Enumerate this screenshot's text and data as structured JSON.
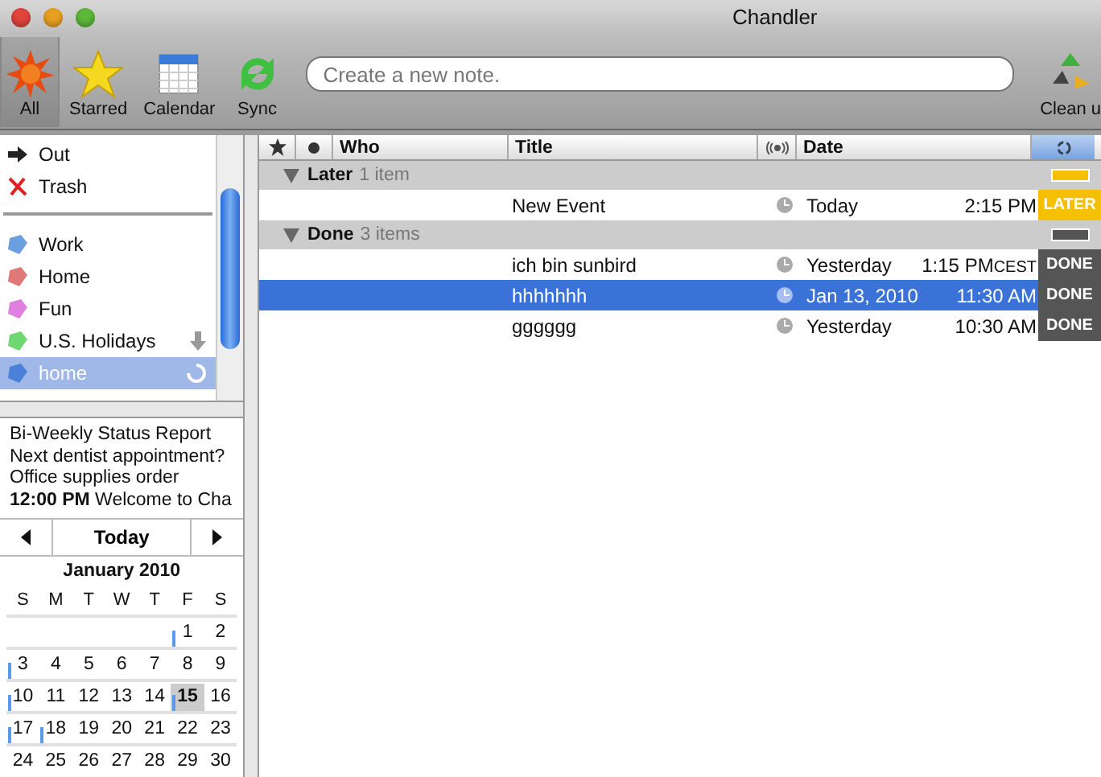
{
  "window": {
    "title": "Chandler"
  },
  "toolbar": {
    "buttons": [
      {
        "label": "All",
        "kind": "all",
        "selected": true
      },
      {
        "label": "Starred",
        "kind": "starred",
        "selected": false
      },
      {
        "label": "Calendar",
        "kind": "calendar",
        "selected": false
      },
      {
        "label": "Sync",
        "kind": "sync",
        "selected": false
      }
    ],
    "search": {
      "placeholder": "Create a new note."
    },
    "clean_button": {
      "label": "Clean u"
    }
  },
  "sidebar": {
    "top_items": [
      {
        "label": "Out",
        "kind": "out"
      },
      {
        "label": "Trash",
        "kind": "trash"
      }
    ],
    "collections": [
      {
        "label": "Work",
        "color": "#6a9fe0",
        "selected": false,
        "subscribed": false,
        "syncing": false
      },
      {
        "label": "Home",
        "color": "#e07878",
        "selected": false,
        "subscribed": false,
        "syncing": false
      },
      {
        "label": "Fun",
        "color": "#e080e0",
        "selected": false,
        "subscribed": false,
        "syncing": false
      },
      {
        "label": "U.S. Holidays",
        "color": "#70d870",
        "selected": false,
        "subscribed": true,
        "syncing": false
      },
      {
        "label": "home",
        "color": "#4a80d8",
        "selected": true,
        "subscribed": false,
        "syncing": true
      }
    ]
  },
  "preview": {
    "lines": [
      "Bi-Weekly Status Report",
      "Next dentist appointment?",
      "Office supplies order",
      "**12:00 PM** Welcome to Cha"
    ]
  },
  "mini_calendar": {
    "today_button": "Today",
    "month": "January 2010",
    "weekdays": [
      "S",
      "M",
      "T",
      "W",
      "T",
      "F",
      "S"
    ],
    "weeks": [
      {
        "partial_start": true,
        "days": [
          {
            "day": "1",
            "event": true,
            "selected": false
          },
          {
            "day": "2",
            "event": false,
            "selected": false
          }
        ]
      },
      {
        "days": [
          {
            "day": "3",
            "event": true,
            "selected": false
          },
          {
            "day": "4",
            "event": false,
            "selected": false
          },
          {
            "day": "5",
            "event": false,
            "selected": false
          },
          {
            "day": "6",
            "event": false,
            "selected": false
          },
          {
            "day": "7",
            "event": false,
            "selected": false
          },
          {
            "day": "8",
            "event": false,
            "selected": false
          },
          {
            "day": "9",
            "event": false,
            "selected": false
          }
        ]
      },
      {
        "days": [
          {
            "day": "10",
            "event": true,
            "selected": false
          },
          {
            "day": "11",
            "event": false,
            "selected": false
          },
          {
            "day": "12",
            "event": false,
            "selected": false
          },
          {
            "day": "13",
            "event": false,
            "selected": false
          },
          {
            "day": "14",
            "event": false,
            "selected": false
          },
          {
            "day": "15",
            "event": true,
            "selected": true
          },
          {
            "day": "16",
            "event": false,
            "selected": false
          }
        ]
      },
      {
        "days": [
          {
            "day": "17",
            "event": true,
            "selected": false
          },
          {
            "day": "18",
            "event": true,
            "selected": false
          },
          {
            "day": "19",
            "event": false,
            "selected": false
          },
          {
            "day": "20",
            "event": false,
            "selected": false
          },
          {
            "day": "21",
            "event": false,
            "selected": false
          },
          {
            "day": "22",
            "event": false,
            "selected": false
          },
          {
            "day": "23",
            "event": false,
            "selected": false
          }
        ]
      },
      {
        "days": [
          {
            "day": "24",
            "event": false,
            "selected": false
          },
          {
            "day": "25",
            "event": false,
            "selected": false
          },
          {
            "day": "26",
            "event": false,
            "selected": false
          },
          {
            "day": "27",
            "event": false,
            "selected": false
          },
          {
            "day": "28",
            "event": false,
            "selected": false
          },
          {
            "day": "29",
            "event": false,
            "selected": false
          },
          {
            "day": "30",
            "event": false,
            "selected": false
          }
        ]
      }
    ]
  },
  "table": {
    "columns": [
      "Who",
      "Title",
      "Date"
    ],
    "sections": [
      {
        "label": "Later",
        "count": "1 item",
        "color": "#f5c000",
        "expanded": true,
        "rows": [
          {
            "title": "New Event",
            "date": "Today",
            "time": "2:15 PM",
            "status": "LATER",
            "color": "#f5c000",
            "selected": false
          }
        ]
      },
      {
        "label": "Done",
        "count": "3 items",
        "color": "#555555",
        "expanded": true,
        "rows": [
          {
            "title": "ich bin sunbird",
            "date": "Yesterday",
            "time": "1:15 PM",
            "zone": "CEST",
            "status": "DONE",
            "color": "#555555",
            "selected": false
          },
          {
            "title": "hhhhhhh",
            "date": "Jan 13, 2010",
            "time": "11:30 AM",
            "status": "DONE",
            "color": "#555555",
            "selected": true
          },
          {
            "title": "gggggg",
            "date": "Yesterday",
            "time": "10:30 AM",
            "status": "DONE",
            "color": "#555555",
            "selected": false
          }
        ]
      }
    ]
  }
}
